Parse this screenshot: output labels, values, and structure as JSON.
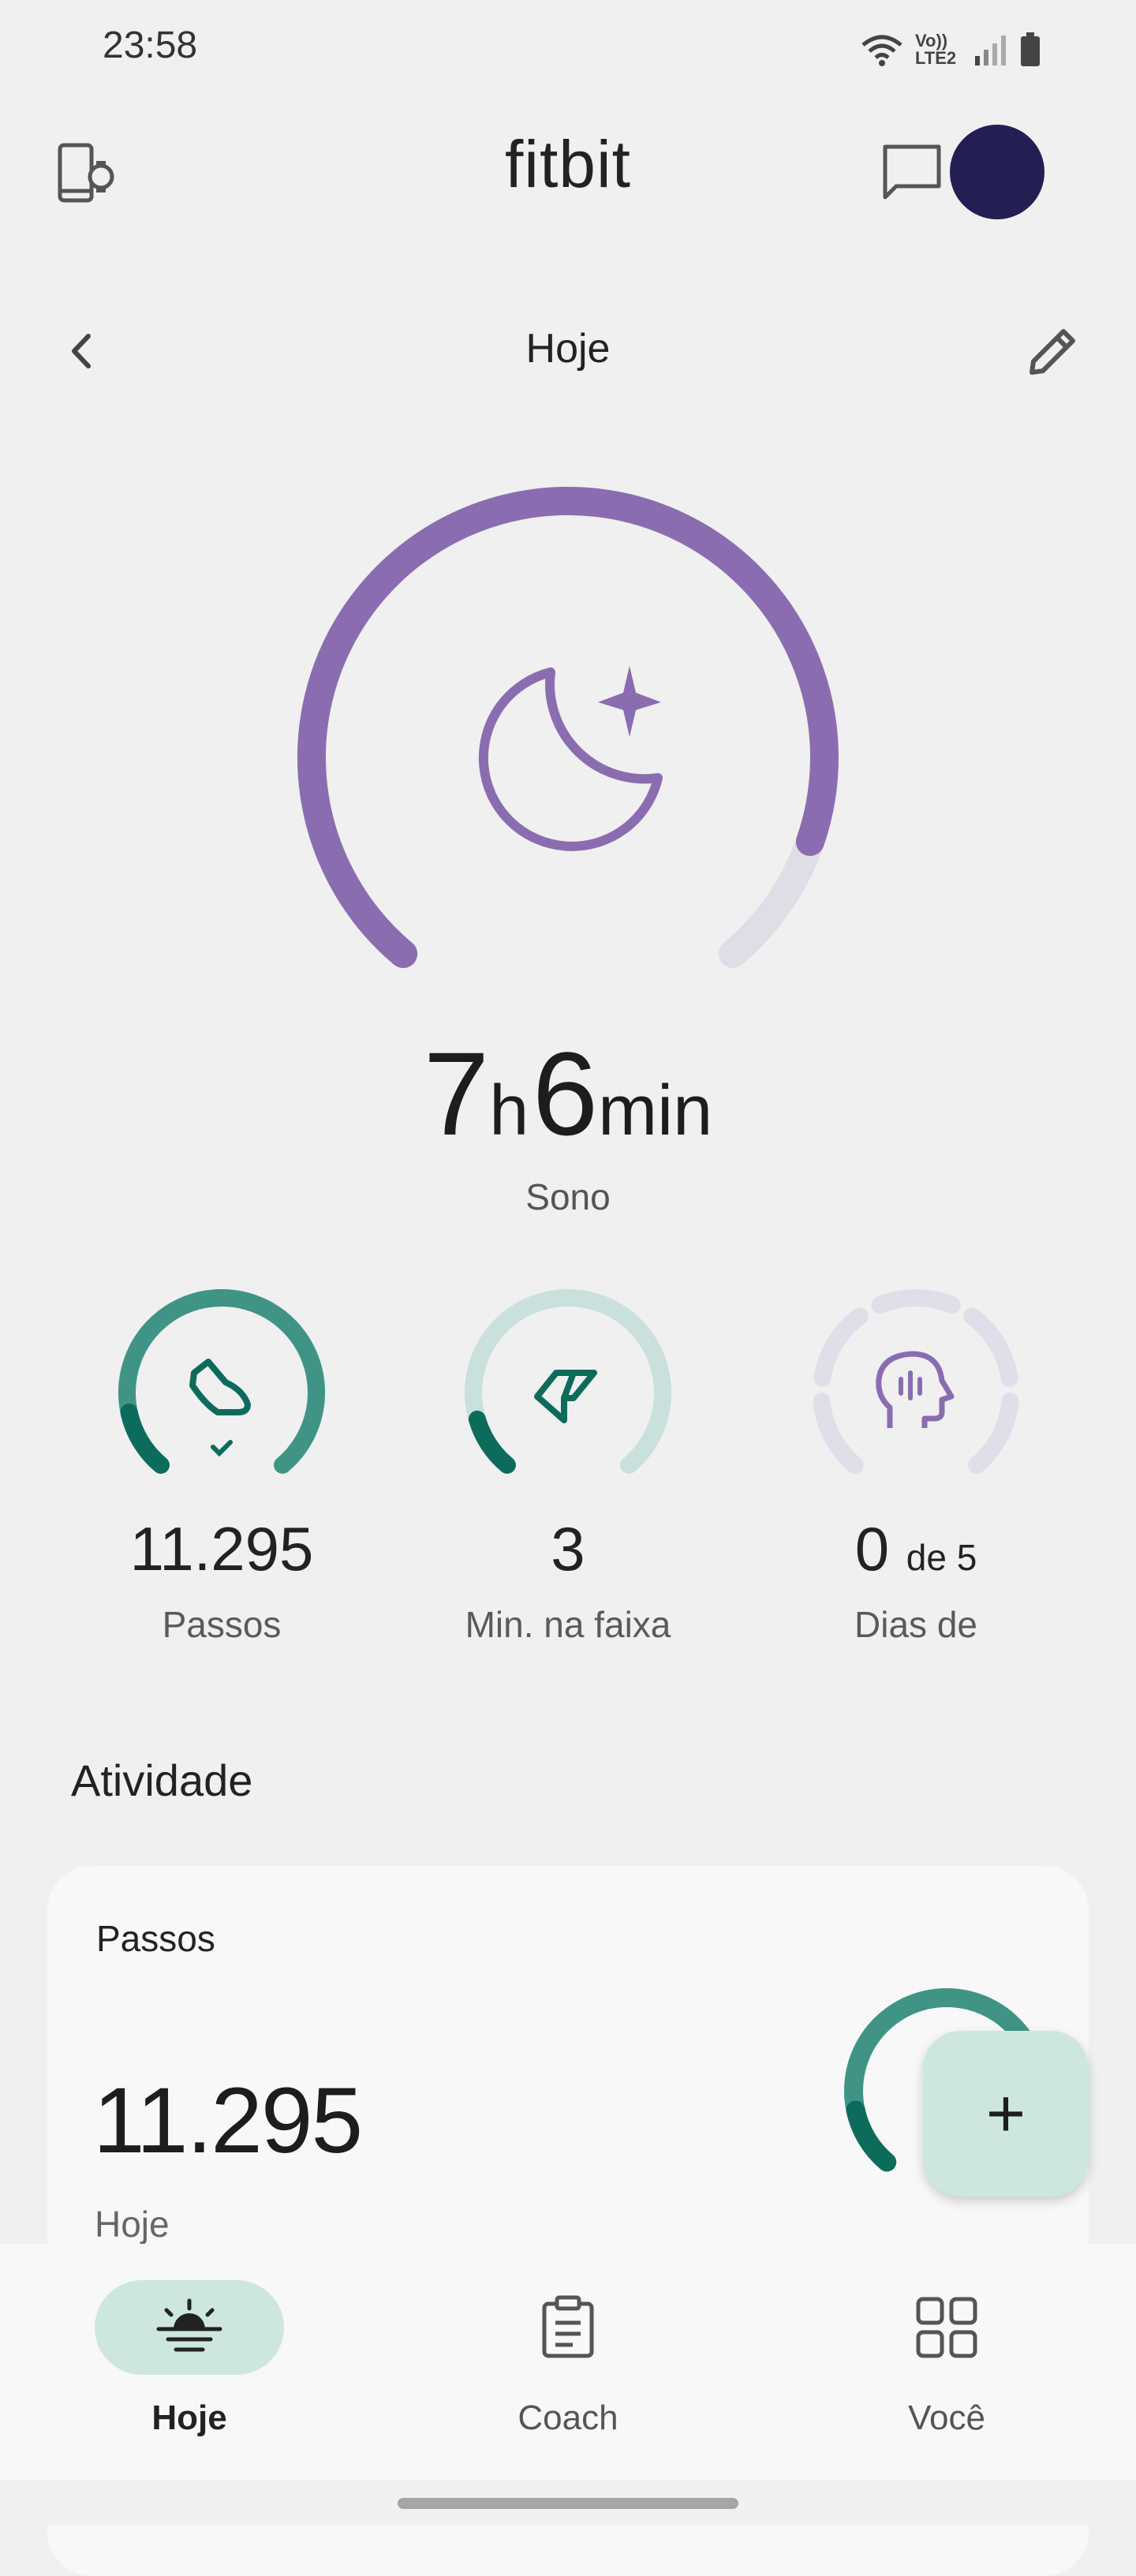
{
  "status": {
    "time": "23:58",
    "network_label": "Vo)) LTE2"
  },
  "app": {
    "title": "fitbit"
  },
  "nav": {
    "title": "Hoje"
  },
  "sleep": {
    "hours": "7",
    "hours_unit": "h",
    "minutes": "6",
    "minutes_unit": "min",
    "label": "Sono",
    "progress": 0.89
  },
  "metrics": [
    {
      "value": "11.295",
      "label": "Passos",
      "progress": 1.0,
      "icon": "shoe-icon"
    },
    {
      "value": "3",
      "label": "Min. na faixa",
      "progress": 0.12,
      "icon": "zone-arrow-icon"
    },
    {
      "value": "0",
      "value_suffix": "de 5",
      "label": "Dias de",
      "progress": 0.0,
      "icon": "mindful-head-icon"
    }
  ],
  "activity": {
    "section_title": "Atividade",
    "card_title": "Passos",
    "value": "11.295",
    "sub": "Hoje"
  },
  "fab": {
    "symbol": "+"
  },
  "bottom_nav": [
    {
      "label": "Hoje",
      "icon": "sunrise-icon",
      "active": true
    },
    {
      "label": "Coach",
      "icon": "clipboard-icon",
      "active": false
    },
    {
      "label": "Você",
      "icon": "grid-icon",
      "active": false
    }
  ],
  "colors": {
    "sleep": "#8a6db1",
    "steps": "#3f9486",
    "zone": "#0d6b5c",
    "mindful": "#8a6db1",
    "bg": "#eff0ef"
  }
}
